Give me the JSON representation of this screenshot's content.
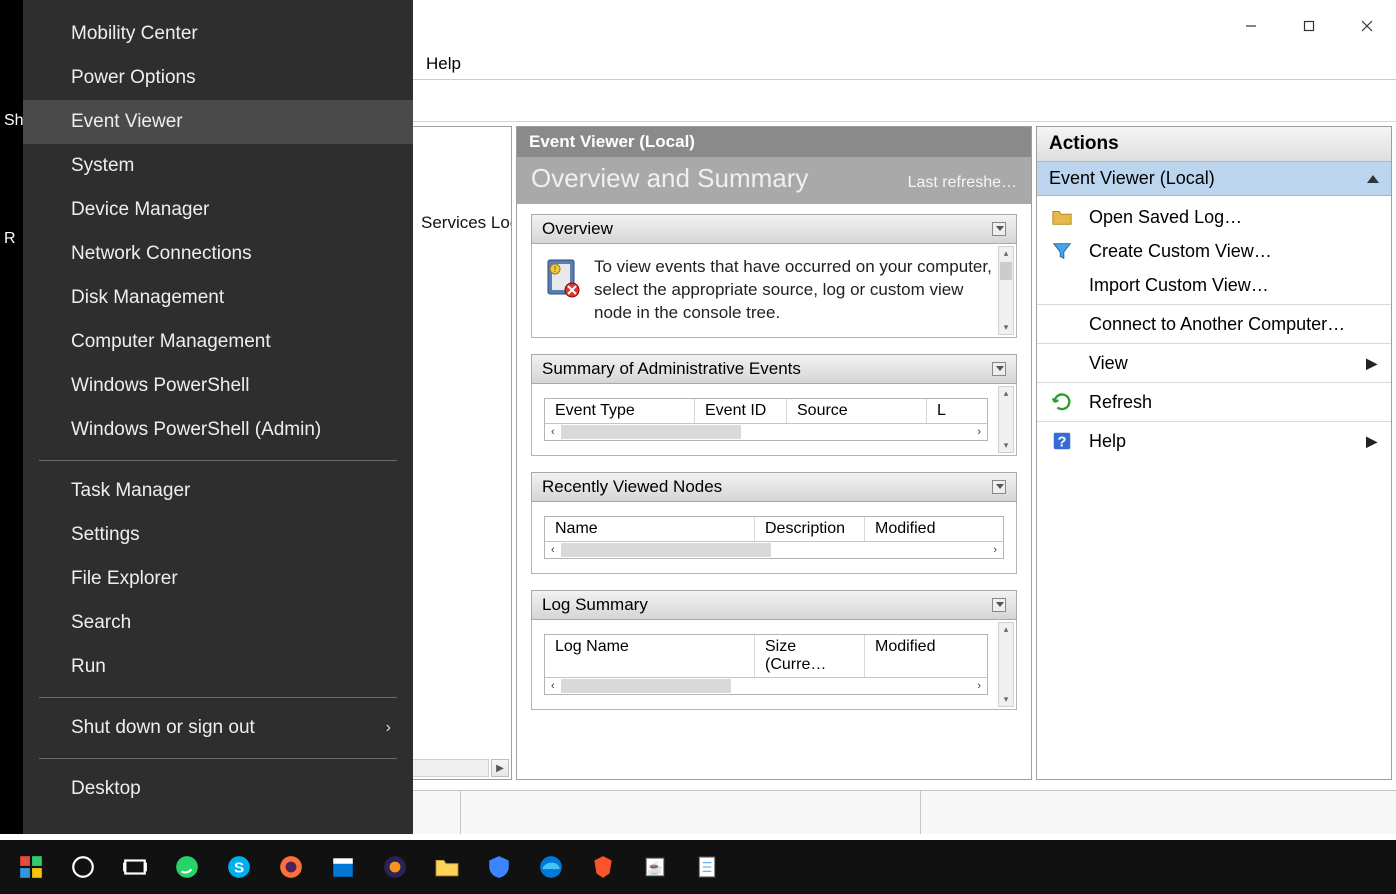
{
  "window": {
    "menubar": {
      "help": "Help"
    }
  },
  "tree": {
    "snippet": "Services Log"
  },
  "center": {
    "title": "Event Viewer (Local)",
    "heading": "Overview and Summary",
    "last_refreshed": "Last refreshe…",
    "overview": {
      "header": "Overview",
      "text": "To view events that have occurred on your computer, select the appropriate source, log or custom view node in the console tree."
    },
    "admin_events": {
      "header": "Summary of Administrative Events",
      "cols": [
        "Event Type",
        "Event ID",
        "Source",
        "L"
      ]
    },
    "recent_nodes": {
      "header": "Recently Viewed Nodes",
      "cols": [
        "Name",
        "Description",
        "Modified"
      ]
    },
    "log_summary": {
      "header": "Log Summary",
      "cols": [
        "Log Name",
        "Size (Curre…",
        "Modified"
      ]
    }
  },
  "actions": {
    "title": "Actions",
    "subtitle": "Event Viewer (Local)",
    "items": [
      {
        "label": "Open Saved Log…",
        "icon": "folder"
      },
      {
        "label": "Create Custom View…",
        "icon": "funnel"
      },
      {
        "label": "Import Custom View…",
        "icon": "none"
      },
      {
        "sep": true
      },
      {
        "label": "Connect to Another Computer…",
        "icon": "none"
      },
      {
        "sep": true
      },
      {
        "label": "View",
        "icon": "none",
        "submenu": true
      },
      {
        "sep": true
      },
      {
        "label": "Refresh",
        "icon": "refresh"
      },
      {
        "sep": true
      },
      {
        "label": "Help",
        "icon": "help",
        "submenu": true
      }
    ]
  },
  "winx": {
    "groups": [
      [
        "Mobility Center",
        "Power Options",
        "Event Viewer",
        "System",
        "Device Manager",
        "Network Connections",
        "Disk Management",
        "Computer Management",
        "Windows PowerShell",
        "Windows PowerShell (Admin)"
      ],
      [
        "Task Manager",
        "Settings",
        "File Explorer",
        "Search",
        "Run"
      ],
      [
        "Shut down or sign out"
      ],
      [
        "Desktop"
      ]
    ],
    "highlighted": "Event Viewer",
    "submenu_item": "Shut down or sign out"
  },
  "left_strip": [
    "Sh",
    "R"
  ],
  "taskbar_icons": [
    "start",
    "cortana",
    "taskview",
    "whatsapp",
    "skype",
    "firefox",
    "calendar",
    "eclipse",
    "explorer",
    "defender",
    "edge",
    "brave",
    "java",
    "notepad"
  ]
}
